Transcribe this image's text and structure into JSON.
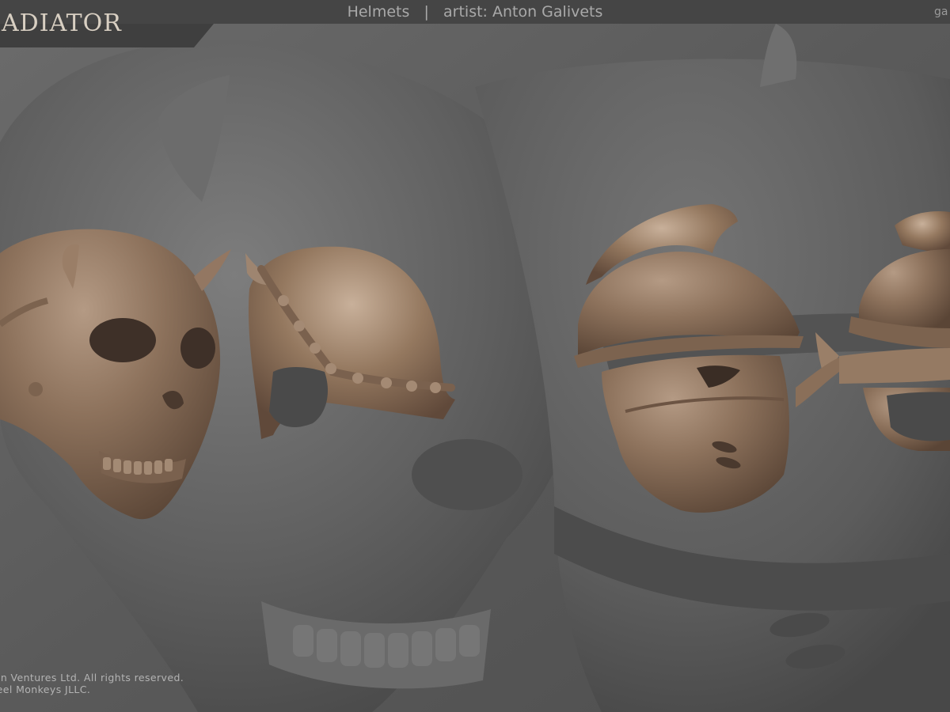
{
  "header": {
    "title": "Helmets   |   artist: Anton Galivets",
    "right_text": "ga"
  },
  "logo": {
    "text": "ADIATOR"
  },
  "footer": {
    "line1": "sion Ventures Ltd. All rights reserved.",
    "line2": "Steel Monkeys JLLC."
  },
  "colors": {
    "background": "#5b5b5b",
    "header_bar": "#454545",
    "model_bronze": "#8a6e58"
  },
  "render": {
    "subject": "four bronze-coloured 3D helmet sculpts over a large grey close-up backdrop",
    "helmets": [
      {
        "name": "horned-skull-helmet"
      },
      {
        "name": "horned-rimmed-helmet"
      },
      {
        "name": "crested-visor-helmet"
      },
      {
        "name": "crested-helmet-partial"
      }
    ]
  }
}
